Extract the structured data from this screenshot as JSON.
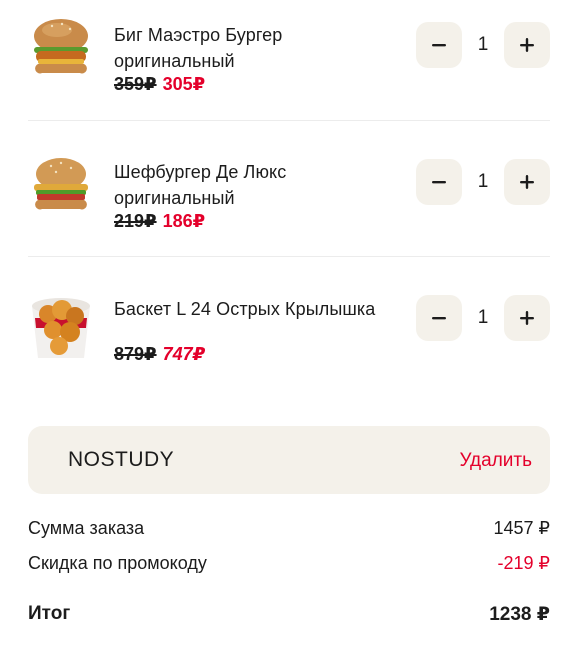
{
  "cart": {
    "items": [
      {
        "name": "Биг Маэстро Бургер оригинальный",
        "old_price": "359₽",
        "new_price": "305₽",
        "quantity": "1",
        "image_icon": "burger-icon"
      },
      {
        "name": "Шефбургер Де Люкс оригинальный",
        "old_price": "219₽",
        "new_price": "186₽",
        "quantity": "1",
        "image_icon": "burger-icon"
      },
      {
        "name": "Баскет L 24 Острых Крылышка",
        "old_price": "879₽",
        "new_price": "747₽",
        "quantity": "1",
        "image_icon": "chicken-bucket-icon"
      }
    ],
    "stepper": {
      "minus_icon": "minus-icon",
      "plus_icon": "plus-icon"
    }
  },
  "promo": {
    "code": "NOSTUDY",
    "remove_label": "Удалить"
  },
  "summary": {
    "order_sum_label": "Сумма заказа",
    "order_sum_value": "1457 ₽",
    "discount_label": "Скидка по промокоду",
    "discount_value": "-219 ₽",
    "total_label": "Итог",
    "total_value": "1238 ₽"
  },
  "colors": {
    "accent": "#e4002b",
    "button_bg": "#f4f1ea",
    "text": "#1c1c1c"
  }
}
